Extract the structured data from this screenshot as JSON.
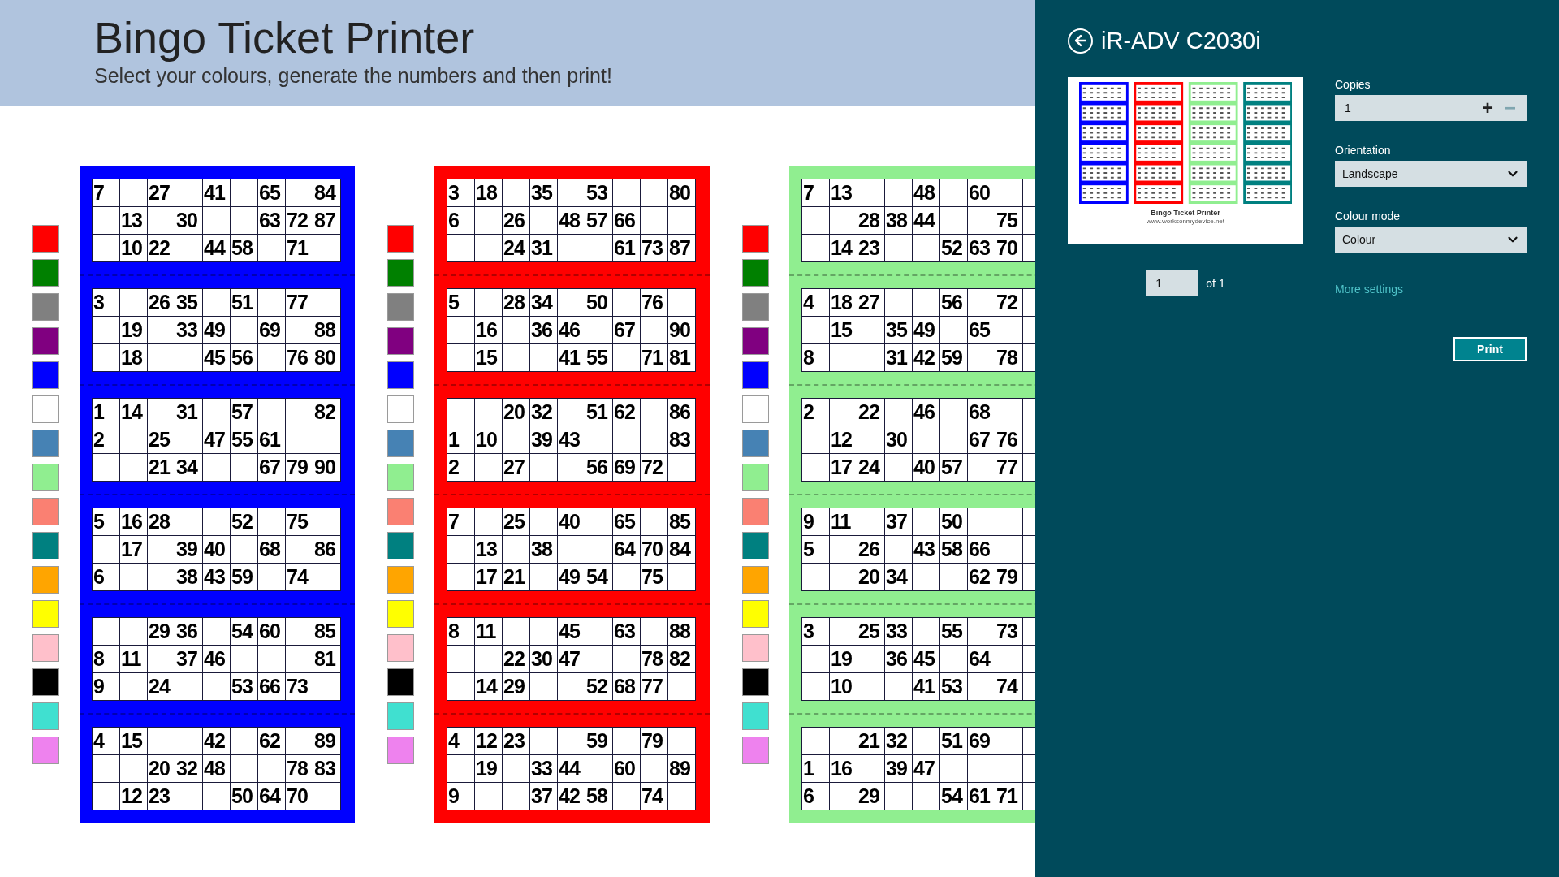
{
  "header": {
    "title": "Bingo Ticket Printer",
    "subtitle": "Select your colours, generate the numbers and then print!"
  },
  "ticket_columns": [
    {
      "color": "#0000ff",
      "swatches": [
        {
          "color": "#ff0000"
        },
        {
          "color": "#008000"
        },
        {
          "color": "#808080"
        },
        {
          "color": "#800080"
        },
        {
          "color": "#0000ff"
        },
        {
          "color": "#ffffff"
        },
        {
          "color": "#4682b4"
        },
        {
          "color": "#90ee90"
        },
        {
          "color": "#fa8072"
        },
        {
          "color": "#008080"
        },
        {
          "color": "#ffa500"
        },
        {
          "color": "#ffff00"
        },
        {
          "color": "#ffc0cb"
        },
        {
          "color": "#000000"
        },
        {
          "color": "#40e0d0"
        },
        {
          "color": "#ee82ee"
        }
      ],
      "tickets": [
        {
          "rows": [
            [
              "7",
              null,
              "27",
              null,
              "41",
              null,
              "65",
              null,
              "84"
            ],
            [
              null,
              "13",
              null,
              "30",
              null,
              null,
              "63",
              "72",
              "87"
            ],
            [
              null,
              "10",
              "22",
              null,
              "44",
              "58",
              null,
              "71",
              null
            ]
          ]
        },
        {
          "rows": [
            [
              "3",
              null,
              "26",
              "35",
              null,
              "51",
              null,
              "77",
              null
            ],
            [
              null,
              "19",
              null,
              "33",
              "49",
              null,
              "69",
              null,
              "88"
            ],
            [
              null,
              "18",
              null,
              null,
              "45",
              "56",
              null,
              "76",
              "80"
            ]
          ]
        },
        {
          "rows": [
            [
              "1",
              "14",
              null,
              "31",
              null,
              "57",
              null,
              null,
              "82"
            ],
            [
              "2",
              null,
              "25",
              null,
              "47",
              "55",
              "61",
              null,
              null
            ],
            [
              null,
              null,
              "21",
              "34",
              null,
              null,
              "67",
              "79",
              "90"
            ]
          ]
        },
        {
          "rows": [
            [
              "5",
              "16",
              "28",
              null,
              null,
              "52",
              null,
              "75",
              null
            ],
            [
              null,
              "17",
              null,
              "39",
              "40",
              null,
              "68",
              null,
              "86"
            ],
            [
              "6",
              null,
              null,
              "38",
              "43",
              "59",
              null,
              "74",
              null
            ]
          ]
        },
        {
          "rows": [
            [
              null,
              null,
              "29",
              "36",
              null,
              "54",
              "60",
              null,
              "85"
            ],
            [
              "8",
              "11",
              null,
              "37",
              "46",
              null,
              null,
              null,
              "81"
            ],
            [
              "9",
              null,
              "24",
              null,
              null,
              "53",
              "66",
              "73",
              null
            ]
          ]
        },
        {
          "rows": [
            [
              "4",
              "15",
              null,
              null,
              "42",
              null,
              "62",
              null,
              "89"
            ],
            [
              null,
              null,
              "20",
              "32",
              "48",
              null,
              null,
              "78",
              "83"
            ],
            [
              null,
              "12",
              "23",
              null,
              null,
              "50",
              "64",
              "70",
              null
            ]
          ]
        }
      ]
    },
    {
      "color": "#ff0000",
      "swatches": [
        {
          "color": "#ff0000"
        },
        {
          "color": "#008000"
        },
        {
          "color": "#808080"
        },
        {
          "color": "#800080"
        },
        {
          "color": "#0000ff"
        },
        {
          "color": "#ffffff"
        },
        {
          "color": "#4682b4"
        },
        {
          "color": "#90ee90"
        },
        {
          "color": "#fa8072"
        },
        {
          "color": "#008080"
        },
        {
          "color": "#ffa500"
        },
        {
          "color": "#ffff00"
        },
        {
          "color": "#ffc0cb"
        },
        {
          "color": "#000000"
        },
        {
          "color": "#40e0d0"
        },
        {
          "color": "#ee82ee"
        }
      ],
      "tickets": [
        {
          "rows": [
            [
              "3",
              "18",
              null,
              "35",
              null,
              "53",
              null,
              null,
              "80"
            ],
            [
              "6",
              null,
              "26",
              null,
              "48",
              "57",
              "66",
              null,
              null
            ],
            [
              null,
              null,
              "24",
              "31",
              null,
              null,
              "61",
              "73",
              "87"
            ]
          ]
        },
        {
          "rows": [
            [
              "5",
              null,
              "28",
              "34",
              null,
              "50",
              null,
              "76",
              null
            ],
            [
              null,
              "16",
              null,
              "36",
              "46",
              null,
              "67",
              null,
              "90"
            ],
            [
              null,
              "15",
              null,
              null,
              "41",
              "55",
              null,
              "71",
              "81"
            ]
          ]
        },
        {
          "rows": [
            [
              null,
              null,
              "20",
              "32",
              null,
              "51",
              "62",
              null,
              "86"
            ],
            [
              "1",
              "10",
              null,
              "39",
              "43",
              null,
              null,
              null,
              "83"
            ],
            [
              "2",
              null,
              "27",
              null,
              null,
              "56",
              "69",
              "72",
              null
            ]
          ]
        },
        {
          "rows": [
            [
              "7",
              null,
              "25",
              null,
              "40",
              null,
              "65",
              null,
              "85"
            ],
            [
              null,
              "13",
              null,
              "38",
              null,
              null,
              "64",
              "70",
              "84"
            ],
            [
              null,
              "17",
              "21",
              null,
              "49",
              "54",
              null,
              "75",
              null
            ]
          ]
        },
        {
          "rows": [
            [
              "8",
              "11",
              null,
              null,
              "45",
              null,
              "63",
              null,
              "88"
            ],
            [
              null,
              null,
              "22",
              "30",
              "47",
              null,
              null,
              "78",
              "82"
            ],
            [
              null,
              "14",
              "29",
              null,
              null,
              "52",
              "68",
              "77",
              null
            ]
          ]
        },
        {
          "rows": [
            [
              "4",
              "12",
              "23",
              null,
              null,
              "59",
              null,
              "79",
              null
            ],
            [
              null,
              "19",
              null,
              "33",
              "44",
              null,
              "60",
              null,
              "89"
            ],
            [
              "9",
              null,
              null,
              "37",
              "42",
              "58",
              null,
              "74",
              null
            ]
          ]
        }
      ]
    },
    {
      "color": "#90ee90",
      "swatches": [
        {
          "color": "#ff0000"
        },
        {
          "color": "#008000"
        },
        {
          "color": "#808080"
        },
        {
          "color": "#800080"
        },
        {
          "color": "#0000ff"
        },
        {
          "color": "#ffffff"
        },
        {
          "color": "#4682b4"
        },
        {
          "color": "#90ee90"
        },
        {
          "color": "#fa8072"
        },
        {
          "color": "#008080"
        },
        {
          "color": "#ffa500"
        },
        {
          "color": "#ffff00"
        },
        {
          "color": "#ffc0cb"
        },
        {
          "color": "#000000"
        },
        {
          "color": "#40e0d0"
        },
        {
          "color": "#ee82ee"
        }
      ],
      "tickets": [
        {
          "rows": [
            [
              "7",
              "13",
              null,
              null,
              "48",
              null,
              "60",
              null,
              null
            ],
            [
              null,
              null,
              "28",
              "38",
              "44",
              null,
              null,
              "75",
              null
            ],
            [
              null,
              "14",
              "23",
              null,
              null,
              "52",
              "63",
              "70",
              null
            ]
          ]
        },
        {
          "rows": [
            [
              "4",
              "18",
              "27",
              null,
              null,
              "56",
              null,
              "72",
              null
            ],
            [
              null,
              "15",
              null,
              "35",
              "49",
              null,
              "65",
              null,
              null
            ],
            [
              "8",
              null,
              null,
              "31",
              "42",
              "59",
              null,
              "78",
              null
            ]
          ]
        },
        {
          "rows": [
            [
              "2",
              null,
              "22",
              null,
              "46",
              null,
              "68",
              null,
              null
            ],
            [
              null,
              "12",
              null,
              "30",
              null,
              null,
              "67",
              "76",
              null
            ],
            [
              null,
              "17",
              "24",
              null,
              "40",
              "57",
              null,
              "77",
              null
            ]
          ]
        },
        {
          "rows": [
            [
              "9",
              "11",
              null,
              "37",
              null,
              "50",
              null,
              null,
              null
            ],
            [
              "5",
              null,
              "26",
              null,
              "43",
              "58",
              "66",
              null,
              null
            ],
            [
              null,
              null,
              "20",
              "34",
              null,
              null,
              "62",
              "79",
              null
            ]
          ]
        },
        {
          "rows": [
            [
              "3",
              null,
              "25",
              "33",
              null,
              "55",
              null,
              "73",
              null
            ],
            [
              null,
              "19",
              null,
              "36",
              "45",
              null,
              "64",
              null,
              null
            ],
            [
              null,
              "10",
              null,
              null,
              "41",
              "53",
              null,
              "74",
              null
            ]
          ]
        },
        {
          "rows": [
            [
              null,
              null,
              "21",
              "32",
              null,
              "51",
              "69",
              null,
              null
            ],
            [
              "1",
              "16",
              null,
              "39",
              "47",
              null,
              null,
              null,
              null
            ],
            [
              "6",
              null,
              "29",
              null,
              null,
              "54",
              "61",
              "71",
              null
            ]
          ]
        }
      ]
    }
  ],
  "print_panel": {
    "printer_name": "iR-ADV C2030i",
    "preview": {
      "columns": [
        {
          "color": "#0000ff"
        },
        {
          "color": "#ff0000"
        },
        {
          "color": "#90ee90"
        },
        {
          "color": "#008080"
        }
      ],
      "caption": "Bingo Ticket Printer",
      "url": "www.worksonmydevice.net"
    },
    "page": {
      "value": "1",
      "of_label": "of 1"
    },
    "copies": {
      "label": "Copies",
      "value": "1",
      "plus": "+",
      "minus": "−"
    },
    "orientation": {
      "label": "Orientation",
      "value": "Landscape"
    },
    "colour_mode": {
      "label": "Colour mode",
      "value": "Colour"
    },
    "more_settings": "More settings",
    "print_button": "Print"
  }
}
